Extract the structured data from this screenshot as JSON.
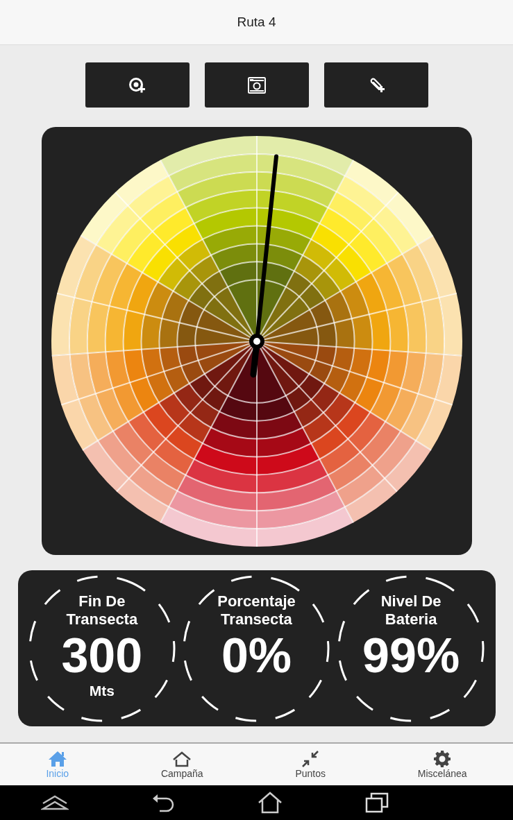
{
  "header": {
    "title": "Ruta 4"
  },
  "toolbar": [
    {
      "kind": "target-add"
    },
    {
      "kind": "camera"
    },
    {
      "kind": "clip-add"
    }
  ],
  "stats": [
    {
      "label": "Fin De Transecta",
      "value": "300",
      "unit": "Mts"
    },
    {
      "label": "Porcentaje Transecta",
      "value": "0%"
    },
    {
      "label": "Nivel De Bateria",
      "value": "99%"
    }
  ],
  "nav": [
    {
      "kind": "home",
      "label": "Inicio",
      "selected": true
    },
    {
      "kind": "outline-home",
      "label": "Campaña",
      "selected": false
    },
    {
      "kind": "collapse",
      "label": "Puntos",
      "selected": false
    },
    {
      "kind": "gear",
      "label": "Miscelánea",
      "selected": false
    }
  ],
  "system_bar": [
    {
      "kind": "up"
    },
    {
      "kind": "back"
    },
    {
      "kind": "home"
    },
    {
      "kind": "recents"
    }
  ]
}
